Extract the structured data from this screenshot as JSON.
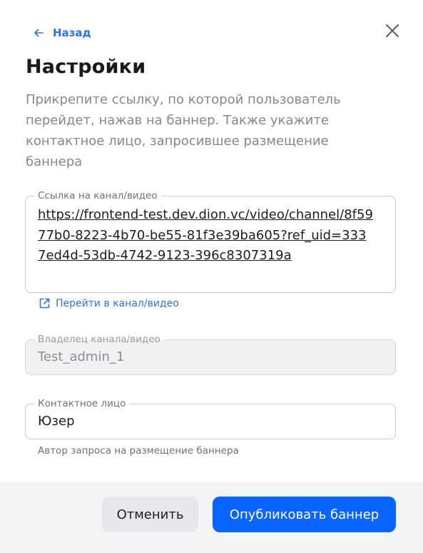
{
  "nav": {
    "back_label": "Назад"
  },
  "header": {
    "title": "Настройки",
    "description": "Прикрепите ссылку, по которой пользователь перейдет, нажав на баннер. Также укажите контактное лицо, запросившее размещение баннера"
  },
  "link_field": {
    "label": "Ссылка на канал/видео",
    "value": "https://frontend-test.dev.dion.vc/video/channel/8f5977b0-8223-4b70-be55-81f3e39ba605?ref_uid=3337ed4d-53db-4742-9123-396c8307319a",
    "action_label": "Перейти в канал/видео"
  },
  "owner_field": {
    "label": "Владелец канала/видео",
    "value": "Test_admin_1"
  },
  "contact_field": {
    "label": "Контактное лицо",
    "value": "Юзер",
    "hint": "Автор запроса на размещение баннера"
  },
  "footer": {
    "cancel_label": "Отменить",
    "publish_label": "Опубликовать баннер"
  },
  "colors": {
    "accent": "#0a64ff",
    "link": "#2d73e8",
    "muted_text": "#85878c",
    "footer_bg": "#f3f4f6"
  },
  "icons": {
    "back": "arrow-left-icon",
    "close": "close-icon",
    "open_link": "external-link-icon"
  }
}
